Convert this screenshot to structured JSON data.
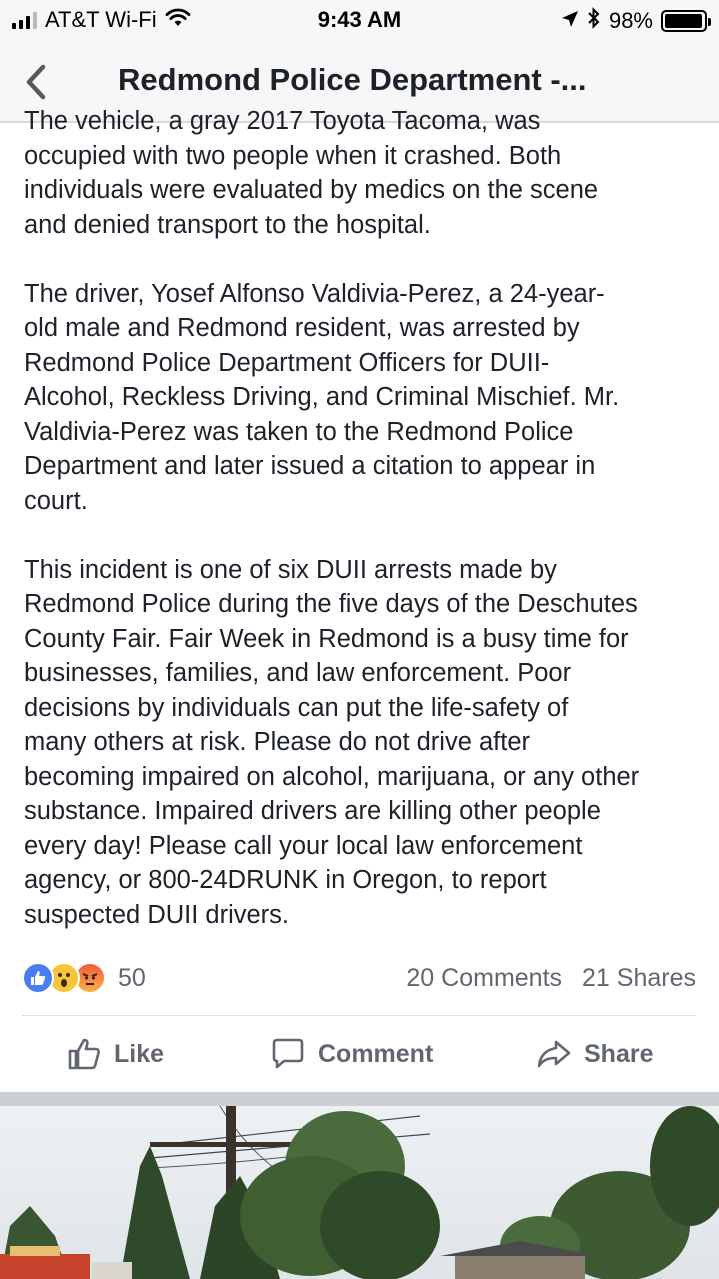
{
  "status_bar": {
    "carrier": "AT&T Wi-Fi",
    "time": "9:43 AM",
    "battery": "98%",
    "battery_level": 0.98
  },
  "nav": {
    "title": "Redmond Police Department -..."
  },
  "post": {
    "paragraphs": [
      "The vehicle, a gray 2017 Toyota Tacoma, was\noccupied with two people when it crashed.  Both\nindividuals were evaluated by medics on the scene\nand denied transport to the hospital.",
      "The driver, Yosef Alfonso Valdivia-Perez, a 24-year-\nold male and Redmond resident, was arrested by\nRedmond Police Department Officers for DUII-\nAlcohol, Reckless Driving, and Criminal Mischief.  Mr.\nValdivia-Perez was taken to the Redmond Police\nDepartment and later issued a citation to appear in\ncourt.",
      "This incident is one of six DUII arrests made by\nRedmond Police during the five days of the Deschutes\nCounty Fair.  Fair Week in Redmond is a busy time for\nbusinesses, families, and law enforcement.  Poor\ndecisions by individuals can put the life-safety of\nmany others at risk.  Please do not drive after\nbecoming impaired on alcohol, marijuana, or any other\nsubstance.  Impaired drivers are killing other people\nevery day!  Please call your local law enforcement\nagency, or 800-24DRUNK in Oregon, to report\nsuspected DUII drivers."
    ]
  },
  "engagement": {
    "reactions_count": "50",
    "comments": "20 Comments",
    "shares": "21 Shares",
    "reaction_types": [
      "like-icon",
      "wow-icon",
      "angry-icon"
    ]
  },
  "actions": {
    "like": "Like",
    "comment": "Comment",
    "share": "Share"
  },
  "colors": {
    "like_blue": "#4a7ef0",
    "text": "#1d2129",
    "muted": "#606770",
    "separator": "#cccfd5"
  }
}
